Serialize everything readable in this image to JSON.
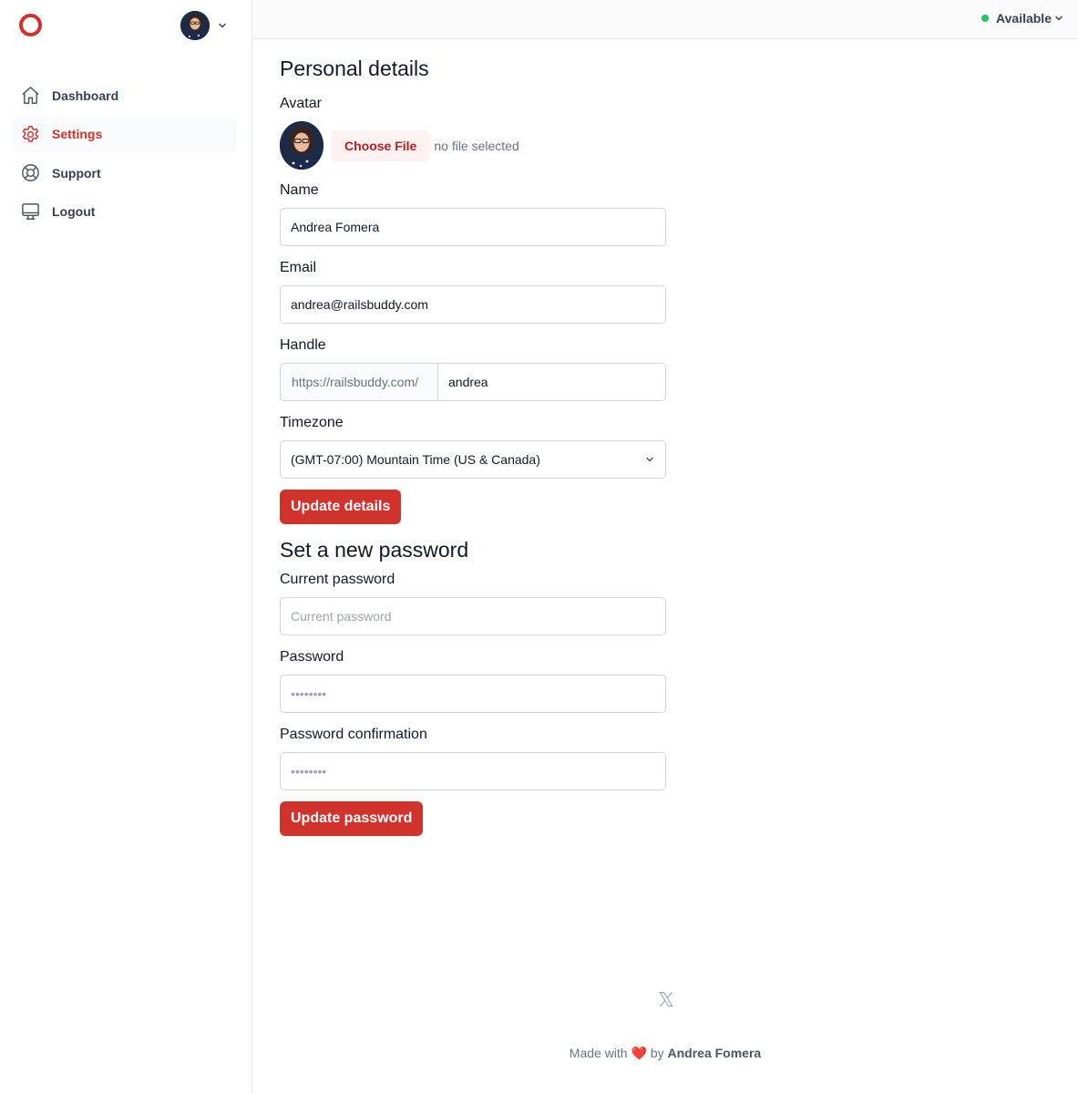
{
  "sidebar": {
    "items": [
      {
        "label": "Dashboard",
        "icon": "home-icon",
        "active": false
      },
      {
        "label": "Settings",
        "icon": "gear-icon",
        "active": true
      },
      {
        "label": "Support",
        "icon": "lifebuoy-icon",
        "active": false
      },
      {
        "label": "Logout",
        "icon": "monitor-icon",
        "active": false
      }
    ]
  },
  "topbar": {
    "status_label": "Available",
    "status_color": "#22c55e"
  },
  "personal": {
    "heading": "Personal details",
    "avatar_label": "Avatar",
    "choose_file_label": "Choose File",
    "file_status": "no file selected",
    "name_label": "Name",
    "name_value": "Andrea Fomera",
    "email_label": "Email",
    "email_value": "andrea@railsbuddy.com",
    "handle_label": "Handle",
    "handle_prefix": "https://railsbuddy.com/",
    "handle_value": "andrea",
    "timezone_label": "Timezone",
    "timezone_value": "(GMT-07:00) Mountain Time (US & Canada)",
    "submit_label": "Update details"
  },
  "password": {
    "heading": "Set a new password",
    "current_label": "Current password",
    "current_placeholder": "Current password",
    "password_label": "Password",
    "password_placeholder": "••••••••",
    "confirm_label": "Password confirmation",
    "confirm_placeholder": "••••••••",
    "submit_label": "Update password"
  },
  "footer": {
    "made_with": "Made with",
    "heart": "❤️",
    "by": "by",
    "author": "Andrea Fomera"
  },
  "colors": {
    "accent": "#d1322c",
    "accent_light": "#fef2f2"
  }
}
